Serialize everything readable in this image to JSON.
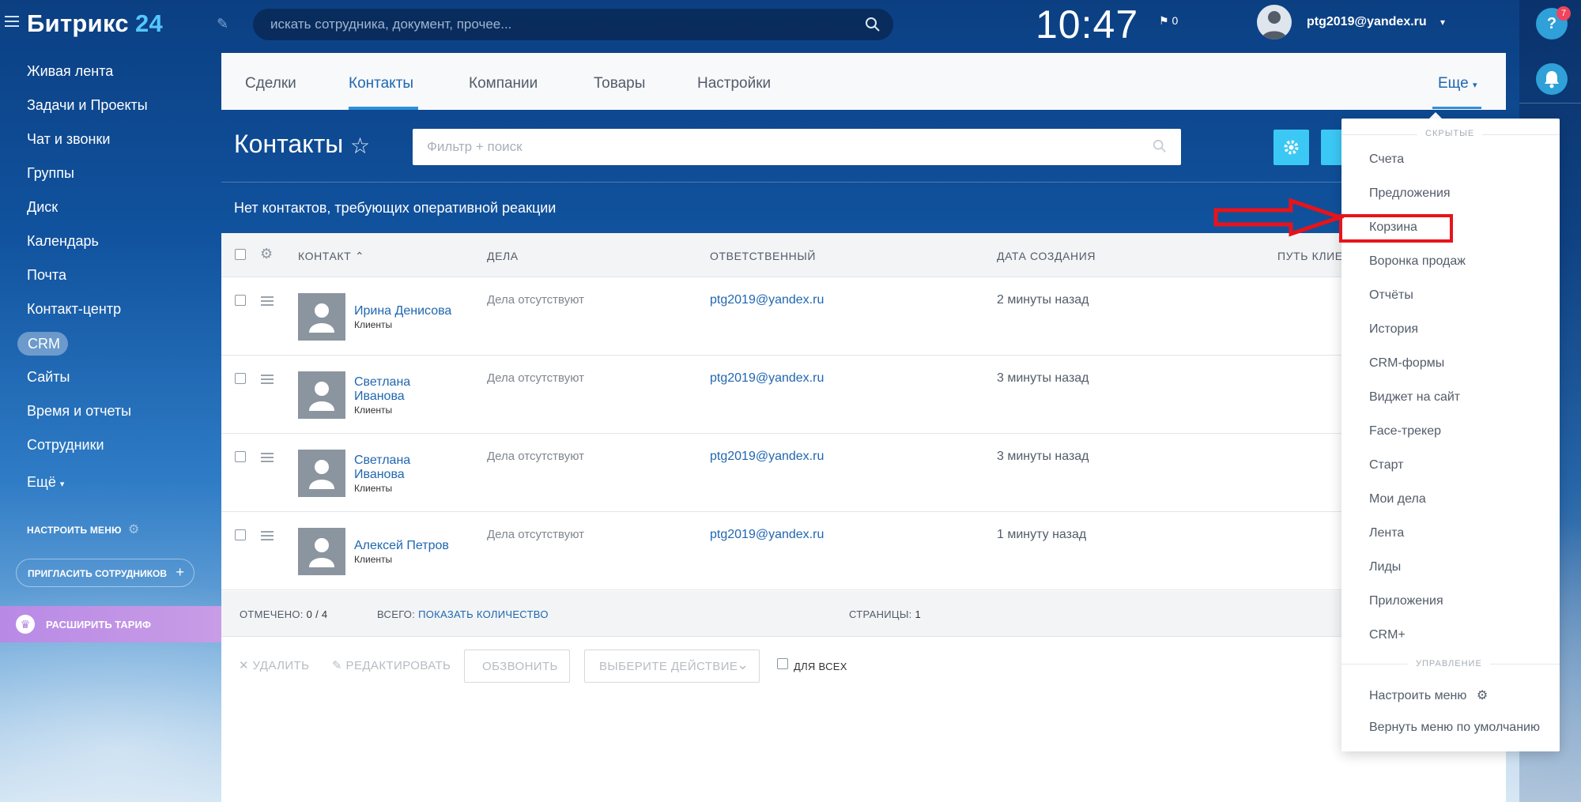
{
  "app": {
    "logo_text": "Битрикс",
    "logo_num": "24",
    "search_placeholder": "искать сотрудника, документ, прочее...",
    "clock": "10:47",
    "flag_count": "0",
    "user_email": "ptg2019@yandex.ru",
    "help_badge": "7"
  },
  "sidebar": {
    "items": [
      {
        "label": "Живая лента"
      },
      {
        "label": "Задачи и Проекты"
      },
      {
        "label": "Чат и звонки"
      },
      {
        "label": "Группы"
      },
      {
        "label": "Диск"
      },
      {
        "label": "Календарь"
      },
      {
        "label": "Почта"
      },
      {
        "label": "Контакт-центр"
      },
      {
        "label": "CRM"
      },
      {
        "label": "Сайты"
      },
      {
        "label": "Время и отчеты"
      },
      {
        "label": "Сотрудники"
      },
      {
        "label": "Ещё"
      }
    ],
    "configure_menu": "НАСТРОИТЬ МЕНЮ",
    "invite": "ПРИГЛАСИТЬ СОТРУДНИКОВ",
    "tariff": "РАСШИРИТЬ ТАРИФ"
  },
  "tabs": [
    "Сделки",
    "Контакты",
    "Компании",
    "Товары",
    "Настройки"
  ],
  "more_tab": "Еще",
  "page": {
    "title": "Контакты",
    "filter_placeholder": "Фильтр + поиск",
    "notice": "Нет контактов, требующих оперативной реакции"
  },
  "table": {
    "headers": [
      "КОНТАКТ",
      "ДЕЛА",
      "ОТВЕТСТВЕННЫЙ",
      "ДАТА СОЗДАНИЯ",
      "ПУТЬ КЛИЕ"
    ],
    "rows": [
      {
        "name": "Ирина Денисова",
        "type": "Клиенты",
        "deals": "Дела отсутствуют",
        "responsible": "ptg2019@yandex.ru",
        "created": "2 минуты назад"
      },
      {
        "name": "Светлана Иванова",
        "type": "Клиенты",
        "deals": "Дела отсутствуют",
        "responsible": "ptg2019@yandex.ru",
        "created": "3 минуты назад"
      },
      {
        "name": "Светлана Иванова",
        "type": "Клиенты",
        "deals": "Дела отсутствуют",
        "responsible": "ptg2019@yandex.ru",
        "created": "3 минуты назад"
      },
      {
        "name": "Алексей Петров",
        "type": "Клиенты",
        "deals": "Дела отсутствуют",
        "responsible": "ptg2019@yandex.ru",
        "created": "1 минуту назад"
      }
    ]
  },
  "footer": {
    "marked_label": "ОТМЕЧЕНО:",
    "marked_value": "0 / 4",
    "total_label": "ВСЕГО:",
    "total_link": "ПОКАЗАТЬ КОЛИЧЕСТВО",
    "pages_label": "СТРАНИЦЫ:",
    "pages_value": "1"
  },
  "actions": {
    "delete": "УДАЛИТЬ",
    "edit": "РЕДАКТИРОВАТЬ",
    "call": "ОБЗВОНИТЬ",
    "choose": "ВЫБЕРИТЕ ДЕЙСТВИЕ",
    "for_all": "ДЛЯ ВСЕХ"
  },
  "menu": {
    "hidden_header": "СКРЫТЫЕ",
    "items": [
      "Счета",
      "Предложения",
      "Корзина",
      "Воронка продаж",
      "Отчёты",
      "История",
      "CRM-формы",
      "Виджет на сайт",
      "Face-трекер",
      "Старт",
      "Мои дела",
      "Лента",
      "Лиды",
      "Приложения",
      "CRM+"
    ],
    "manage_header": "УПРАВЛЕНИЕ",
    "configure": "Настроить меню",
    "reset": "Вернуть меню по умолчанию"
  },
  "colors": {
    "accent": "#2f8fd8",
    "link": "#2067b0",
    "highlight": "#e8131a",
    "button": "#3bc8f5"
  }
}
